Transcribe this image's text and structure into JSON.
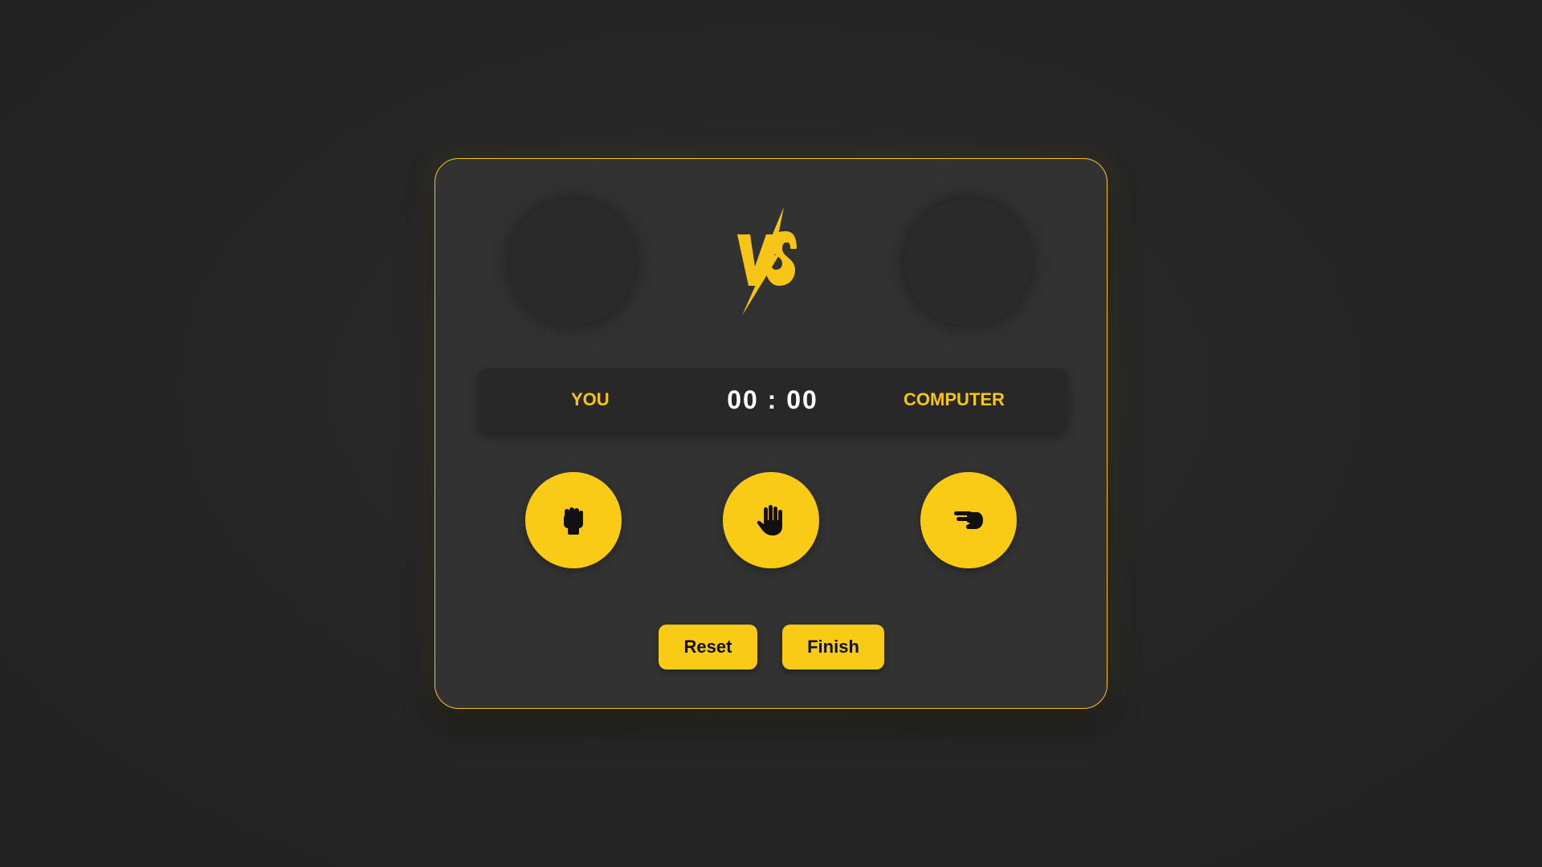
{
  "scoreboard": {
    "player_label": "YOU",
    "score": "00 : 00",
    "computer_label": "COMPUTER"
  },
  "choices": [
    {
      "name": "rock",
      "icon": "fist-icon"
    },
    {
      "name": "paper",
      "icon": "open-hand-icon"
    },
    {
      "name": "scissors",
      "icon": "two-fingers-icon"
    }
  ],
  "buttons": {
    "reset_label": "Reset",
    "finish_label": "Finish"
  },
  "colors": {
    "accent": "#f9cb17",
    "background": "#232323",
    "card": "#323232"
  }
}
